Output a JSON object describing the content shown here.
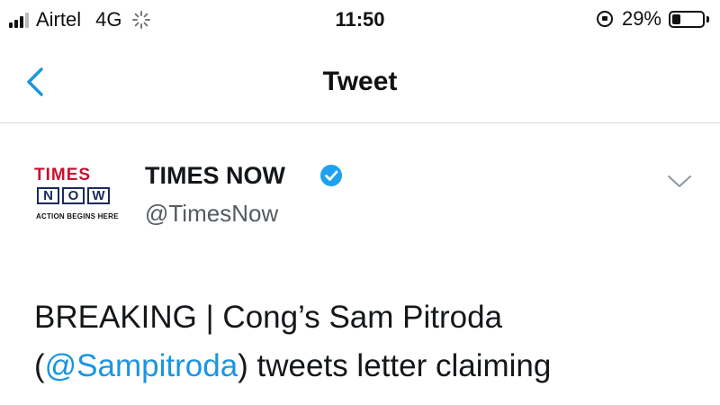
{
  "status_bar": {
    "carrier": "Airtel",
    "network": "4G",
    "time": "11:50",
    "battery_percent_label": "29%",
    "battery_level": 0.29,
    "icons": [
      "signal-icon",
      "loading-spinner-icon",
      "rotation-lock-icon",
      "battery-icon"
    ]
  },
  "nav": {
    "back_icon": "chevron-left-icon",
    "title": "Tweet"
  },
  "tweet": {
    "avatar": {
      "logo_line1": "TIMES",
      "logo_letters": [
        "N",
        "O",
        "W"
      ],
      "logo_tagline": "ACTION BEGINS HERE"
    },
    "display_name": "TIMES NOW",
    "verified": true,
    "handle": "@TimesNow",
    "text_part1": "BREAKING | Cong’s Sam Pitroda",
    "text_paren_open": "(",
    "mention": "@Sampitroda",
    "text_part2": ") tweets letter claiming"
  },
  "colors": {
    "accent": "#1b95e0",
    "verified": "#1da1f2",
    "logo_red": "#c8102e",
    "logo_navy": "#1a2a5e"
  }
}
